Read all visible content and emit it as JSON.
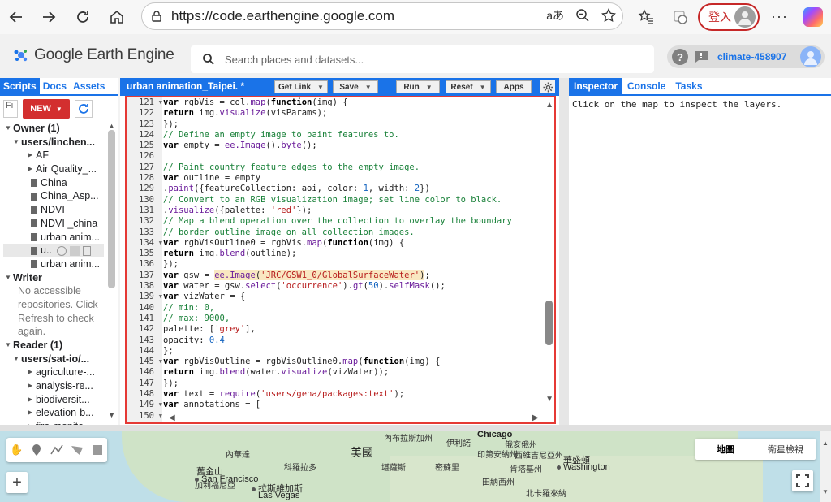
{
  "browser": {
    "url": "https://code.earthengine.google.com",
    "login_label": "登入",
    "translate_label": "aあ"
  },
  "app": {
    "title": "Google Earth Engine",
    "search_placeholder": "Search places and datasets...",
    "project": "climate-458907"
  },
  "left_panel": {
    "tabs": [
      "Scripts",
      "Docs",
      "Assets"
    ],
    "filter_placeholder": "Fi",
    "new_label": "NEW",
    "tree": [
      {
        "kind": "section",
        "label": "Owner (1)"
      },
      {
        "kind": "folder",
        "label": "users/linchen..."
      },
      {
        "kind": "subfolder",
        "label": "AF"
      },
      {
        "kind": "subfolder",
        "label": "Air Quality_..."
      },
      {
        "kind": "file",
        "label": "China"
      },
      {
        "kind": "file",
        "label": "China_Asp..."
      },
      {
        "kind": "file",
        "label": "NDVI"
      },
      {
        "kind": "file",
        "label": "NDVI _china"
      },
      {
        "kind": "file",
        "label": "urban anim..."
      },
      {
        "kind": "file-active",
        "label": "u.."
      },
      {
        "kind": "file",
        "label": "urban anim..."
      },
      {
        "kind": "section",
        "label": "Writer"
      },
      {
        "kind": "note",
        "label": "No accessible"
      },
      {
        "kind": "note",
        "label": "repositories. Click"
      },
      {
        "kind": "note",
        "label": "Refresh to check"
      },
      {
        "kind": "note",
        "label": "again."
      },
      {
        "kind": "section",
        "label": "Reader (1)"
      },
      {
        "kind": "folder",
        "label": "users/sat-io/..."
      },
      {
        "kind": "subfolder",
        "label": "agriculture-..."
      },
      {
        "kind": "subfolder",
        "label": "analysis-re..."
      },
      {
        "kind": "subfolder",
        "label": "biodiversit..."
      },
      {
        "kind": "subfolder",
        "label": "elevation-b..."
      },
      {
        "kind": "subfolder",
        "label": "fire-monito..."
      }
    ]
  },
  "editor": {
    "title": "urban animation_Taipei. *",
    "buttons": {
      "get_link": "Get Link",
      "save": "Save",
      "run": "Run",
      "reset": "Reset",
      "apps": "Apps"
    },
    "lines": [
      {
        "n": "121",
        "fold": true,
        "html": "<span class=\"kw\">var</span> rgbVis = col.<span class=\"fn\">map</span>(<span class=\"kw\">function</span>(img) {"
      },
      {
        "n": "122",
        "fold": false,
        "html": "<span class=\"kw\">return</span> img.<span class=\"fn\">visualize</span>(visParams);"
      },
      {
        "n": "123",
        "fold": false,
        "html": "});"
      },
      {
        "n": "124",
        "fold": false,
        "html": "<span class=\"cm\">// Define an empty image to paint features to.</span>"
      },
      {
        "n": "125",
        "fold": false,
        "html": "<span class=\"kw\">var</span> empty = <span class=\"ee\">ee.Image</span>().<span class=\"fn\">byte</span>();"
      },
      {
        "n": "126",
        "fold": false,
        "html": ""
      },
      {
        "n": "127",
        "fold": false,
        "html": "<span class=\"cm\">// Paint country feature edges to the empty image.</span>"
      },
      {
        "n": "128",
        "fold": false,
        "html": "<span class=\"kw\">var</span> outline = empty"
      },
      {
        "n": "129",
        "fold": false,
        "html": ".<span class=\"fn\">paint</span>({featureCollection: aoi, color: <span class=\"num\">1</span>, width: <span class=\"num\">2</span>})"
      },
      {
        "n": "130",
        "fold": false,
        "html": "<span class=\"cm\">// Convert to an RGB visualization image; set line color to black.</span>"
      },
      {
        "n": "131",
        "fold": false,
        "html": ".<span class=\"fn\">visualize</span>({palette: <span class=\"str\">'red'</span>});"
      },
      {
        "n": "132",
        "fold": false,
        "html": "<span class=\"cm\">// Map a blend operation over the collection to overlay the boundary</span>"
      },
      {
        "n": "133",
        "fold": false,
        "html": "<span class=\"cm\">// border outline image on all collection images.</span>"
      },
      {
        "n": "134",
        "fold": true,
        "html": "<span class=\"kw\">var</span> rgbVisOutline0 = rgbVis.<span class=\"fn\">map</span>(<span class=\"kw\">function</span>(img) {"
      },
      {
        "n": "135",
        "fold": false,
        "html": "<span class=\"kw\">return</span> img.<span class=\"fn\">blend</span>(outline);"
      },
      {
        "n": "136",
        "fold": false,
        "html": "});"
      },
      {
        "n": "137",
        "fold": false,
        "html": "<span class=\"kw\">var</span> gsw = <span class=\"hl\"><span class=\"ee\">ee.Image</span>(<span class=\"str\">'JRC/GSW1_0/GlobalSurfaceWater'</span>)</span>;"
      },
      {
        "n": "138",
        "fold": false,
        "html": "<span class=\"kw\">var</span> water = gsw.<span class=\"fn\">select</span>(<span class=\"str\">'occurrence'</span>).<span class=\"fn\">gt</span>(<span class=\"num\">50</span>).<span class=\"fn\">selfMask</span>();"
      },
      {
        "n": "139",
        "fold": true,
        "html": "<span class=\"kw\">var</span> vizWater = {"
      },
      {
        "n": "140",
        "fold": false,
        "html": "<span class=\"cm\">// min: 0,</span>"
      },
      {
        "n": "141",
        "fold": false,
        "html": "<span class=\"cm\">// max: 9000,</span>"
      },
      {
        "n": "142",
        "fold": false,
        "html": "palette: [<span class=\"str\">'grey'</span>],"
      },
      {
        "n": "143",
        "fold": false,
        "html": "opacity: <span class=\"num\">0.4</span>"
      },
      {
        "n": "144",
        "fold": false,
        "html": "};"
      },
      {
        "n": "145",
        "fold": true,
        "html": "<span class=\"kw\">var</span> rgbVisOutline = rgbVisOutline0.<span class=\"fn\">map</span>(<span class=\"kw\">function</span>(img) {"
      },
      {
        "n": "146",
        "fold": false,
        "html": "<span class=\"kw\">return</span> img.<span class=\"fn\">blend</span>(water.<span class=\"fn\">visualize</span>(vizWater));"
      },
      {
        "n": "147",
        "fold": false,
        "html": "});"
      },
      {
        "n": "148",
        "fold": false,
        "html": "<span class=\"kw\">var</span> text = <span class=\"fn\">require</span>(<span class=\"str\">'users/gena/packages:text'</span>);"
      },
      {
        "n": "149",
        "fold": true,
        "html": "<span class=\"kw\">var</span> annotations = ["
      },
      {
        "n": "150",
        "fold": true,
        "html": ""
      }
    ]
  },
  "right_panel": {
    "tabs": [
      "Inspector",
      "Console",
      "Tasks"
    ],
    "hint": "Click on the map to inspect the layers."
  },
  "map": {
    "type_buttons": [
      "地圖",
      "衛星檢視"
    ],
    "labels": {
      "country": "美國",
      "chicago": "Chicago",
      "washington_zh": "華盛頓",
      "washington": "Washington",
      "sf_zh": "舊金山",
      "sf": "San Francisco",
      "lv_zh": "拉斯維加斯",
      "lv": "Las Vegas",
      "nebraska": "內布拉斯加州",
      "illinois": "伊利諾",
      "indiana": "印第安納州",
      "ohio": "俄亥俄州",
      "nevada": "內華達",
      "colorado": "科羅拉多",
      "kansas": "堪薩斯",
      "missouri": "密蘇里",
      "kentucky": "肯塔基州",
      "westvirginia": "西維吉尼亞州",
      "tennessee": "田納西州",
      "ca": "加利福尼亞",
      "nc": "北卡羅來納"
    }
  }
}
